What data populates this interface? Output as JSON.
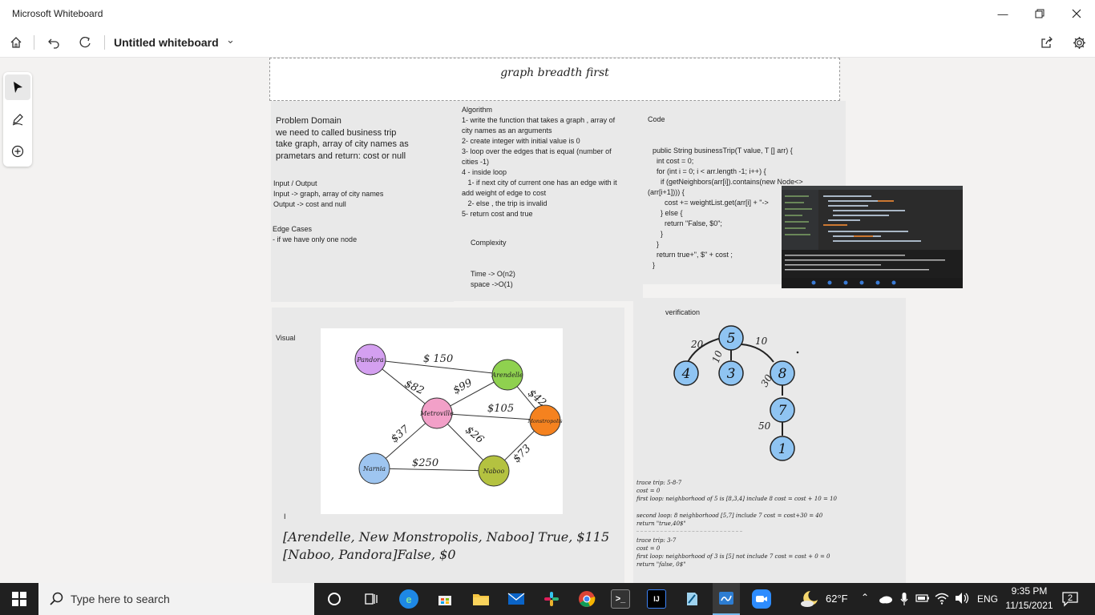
{
  "window": {
    "title": "Microsoft Whiteboard",
    "minimize_icon": "minimize-icon",
    "restore_icon": "restore-icon",
    "close_icon": "close-icon"
  },
  "toolbar": {
    "home_icon": "home-icon",
    "undo_icon": "undo-icon",
    "redo_icon": "redo-icon",
    "board_title": "Untitled whiteboard",
    "share_icon": "share-icon",
    "settings_icon": "gear-icon"
  },
  "toolrail": {
    "items": [
      "select-pointer-icon",
      "pen-icon",
      "add-icon"
    ]
  },
  "board": {
    "title": "graph breadth first",
    "problem": {
      "heading": "Problem Domain",
      "lines": [
        "we need to  called business trip",
        "take graph, array of city names as",
        "prametars and return: cost or null"
      ],
      "io_heading": "Input / Output",
      "io_lines": [
        "Input -> graph, array of city names",
        "Output -> cost and null"
      ],
      "edge_heading": "Edge Cases",
      "edge_lines": [
        "- if we have only one node"
      ]
    },
    "algorithm": {
      "heading": "Algorithm",
      "lines": [
        "1- write the function that takes a graph , array of",
        "city names as an arguments",
        "2- create integer with initial value is 0",
        "3- loop over the edges that is equal (number of",
        "cities -1)",
        "4 - inside loop",
        "   1- if next city of current one has an edge with it",
        "add weight of edge to cost",
        "   2- else , the trip is invalid",
        "5- return cost and true"
      ],
      "complexity_heading": "Complexity",
      "time": "Time -> O(n2)",
      "space": "space ->O(1)"
    },
    "code": {
      "heading": "Code",
      "lines": [
        "public String businessTrip(T value, T [] arr) {",
        "  int cost = 0;",
        "  for (int i = 0; i < arr.length -1; i++) {",
        "    if (getNeighbors(arr[i]).contains(new Node<>",
        "(arr[i+1]))) {",
        "      cost += weightList.get(arr[i] + \"->",
        "    } else {",
        "      return \"False, $0\";",
        "    }",
        "  }",
        "  return true+\", $\" + cost ;",
        "}"
      ]
    },
    "visual": {
      "heading": "Visual",
      "graph": {
        "nodes": [
          "Pandora",
          "Arendelle",
          "Metroville",
          "Monstropolis",
          "Narnia",
          "Naboo"
        ],
        "edges": [
          "$ 150",
          "$82",
          "$99",
          "$42",
          "$105",
          "$37",
          "$26",
          "$250",
          "$73"
        ]
      },
      "cursor_mark": "I",
      "results": [
        "[Arendelle, New Monstropolis, Naboo] True, $115",
        "[Naboo, Pandora]False, $0"
      ]
    },
    "verification": {
      "heading": "verification",
      "tree": {
        "nodes": [
          "5",
          "4",
          "3",
          "8",
          "7",
          "1"
        ],
        "weights": [
          "20",
          "10",
          "10",
          "30",
          "50"
        ]
      },
      "trace1": [
        "trace trip: 5-8-7",
        "cost = 0",
        "first loop: neighborhood of 5 is [8,3,4] include 8 cost = cost + 10 = 10"
      ],
      "trace2": [
        "second loop: 8 neighborhood [5,7] include 7 cost = cost+30 = 40",
        "return \"true,40$\""
      ],
      "trace3": [
        "trace trip: 3-7",
        "cost = 0",
        "first loop: neighborhood of 3 is [5] not include 7 cost = cost + 0 = 0",
        "return \"false, 0$\""
      ]
    }
  },
  "taskbar": {
    "search_placeholder": "Type here to search",
    "apps": [
      "cortana-icon",
      "task-view-icon",
      "edge-icon",
      "store-icon",
      "file-explorer-icon",
      "mail-icon",
      "slack-icon",
      "chrome-icon",
      "terminal-icon",
      "intellij-icon",
      "notepad-icon",
      "whiteboard-icon",
      "zoom-icon"
    ],
    "intellij_label": "IJ",
    "temperature": "62°F",
    "language": "ENG",
    "time": "9:35 PM",
    "date": "11/15/2021",
    "notifications": "2"
  }
}
